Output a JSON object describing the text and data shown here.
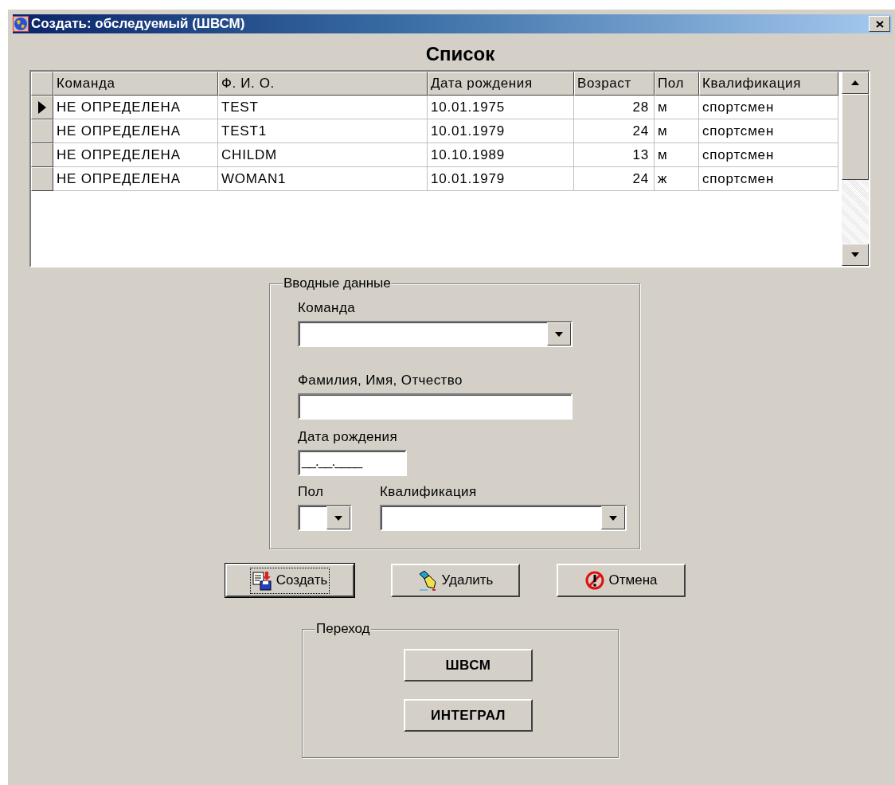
{
  "window": {
    "title": "Создать: обследуемый (ШВСМ)"
  },
  "heading": "Список",
  "table": {
    "columns": [
      "Команда",
      "Ф. И. О.",
      "Дата рождения",
      "Возраст",
      "Пол",
      "Квалификация"
    ],
    "rows": [
      {
        "selected": true,
        "cells": [
          "НЕ ОПРЕДЕЛЕНА",
          "TEST",
          "10.01.1975",
          "28",
          "м",
          "спортсмен"
        ]
      },
      {
        "selected": false,
        "cells": [
          "НЕ ОПРЕДЕЛЕНА",
          "TEST1",
          "10.01.1979",
          "24",
          "м",
          "спортсмен"
        ]
      },
      {
        "selected": false,
        "cells": [
          "НЕ ОПРЕДЕЛЕНА",
          "CHILDM",
          "10.10.1989",
          "13",
          "м",
          "спортсмен"
        ]
      },
      {
        "selected": false,
        "cells": [
          "НЕ ОПРЕДЕЛЕНА",
          "WOMAN1",
          "10.01.1979",
          "24",
          "ж",
          "спортсмен"
        ]
      }
    ]
  },
  "input_group": {
    "title": "Вводные данные",
    "rows": [
      [
        {
          "kind": "combo",
          "label": "Команда"
        }
      ],
      [
        {
          "kind": "text",
          "label": "Фамилия, Имя, Отчество"
        }
      ],
      [
        {
          "kind": "masked",
          "label": "Дата рождения",
          "value": "__.__.____"
        }
      ],
      [
        {
          "kind": "combo",
          "label": "Пол"
        },
        {
          "kind": "combo",
          "label": "Квалификация"
        }
      ]
    ]
  },
  "buttons": [
    {
      "label": "Создать",
      "kind": "create",
      "default": true
    },
    {
      "label": "Удалить",
      "kind": "delete",
      "default": false
    },
    {
      "label": "Отмена",
      "kind": "cancel",
      "default": false
    }
  ],
  "nav_group": {
    "title": "Переход",
    "buttons": [
      "ШВСМ",
      "ИНТЕГРАЛ"
    ]
  }
}
